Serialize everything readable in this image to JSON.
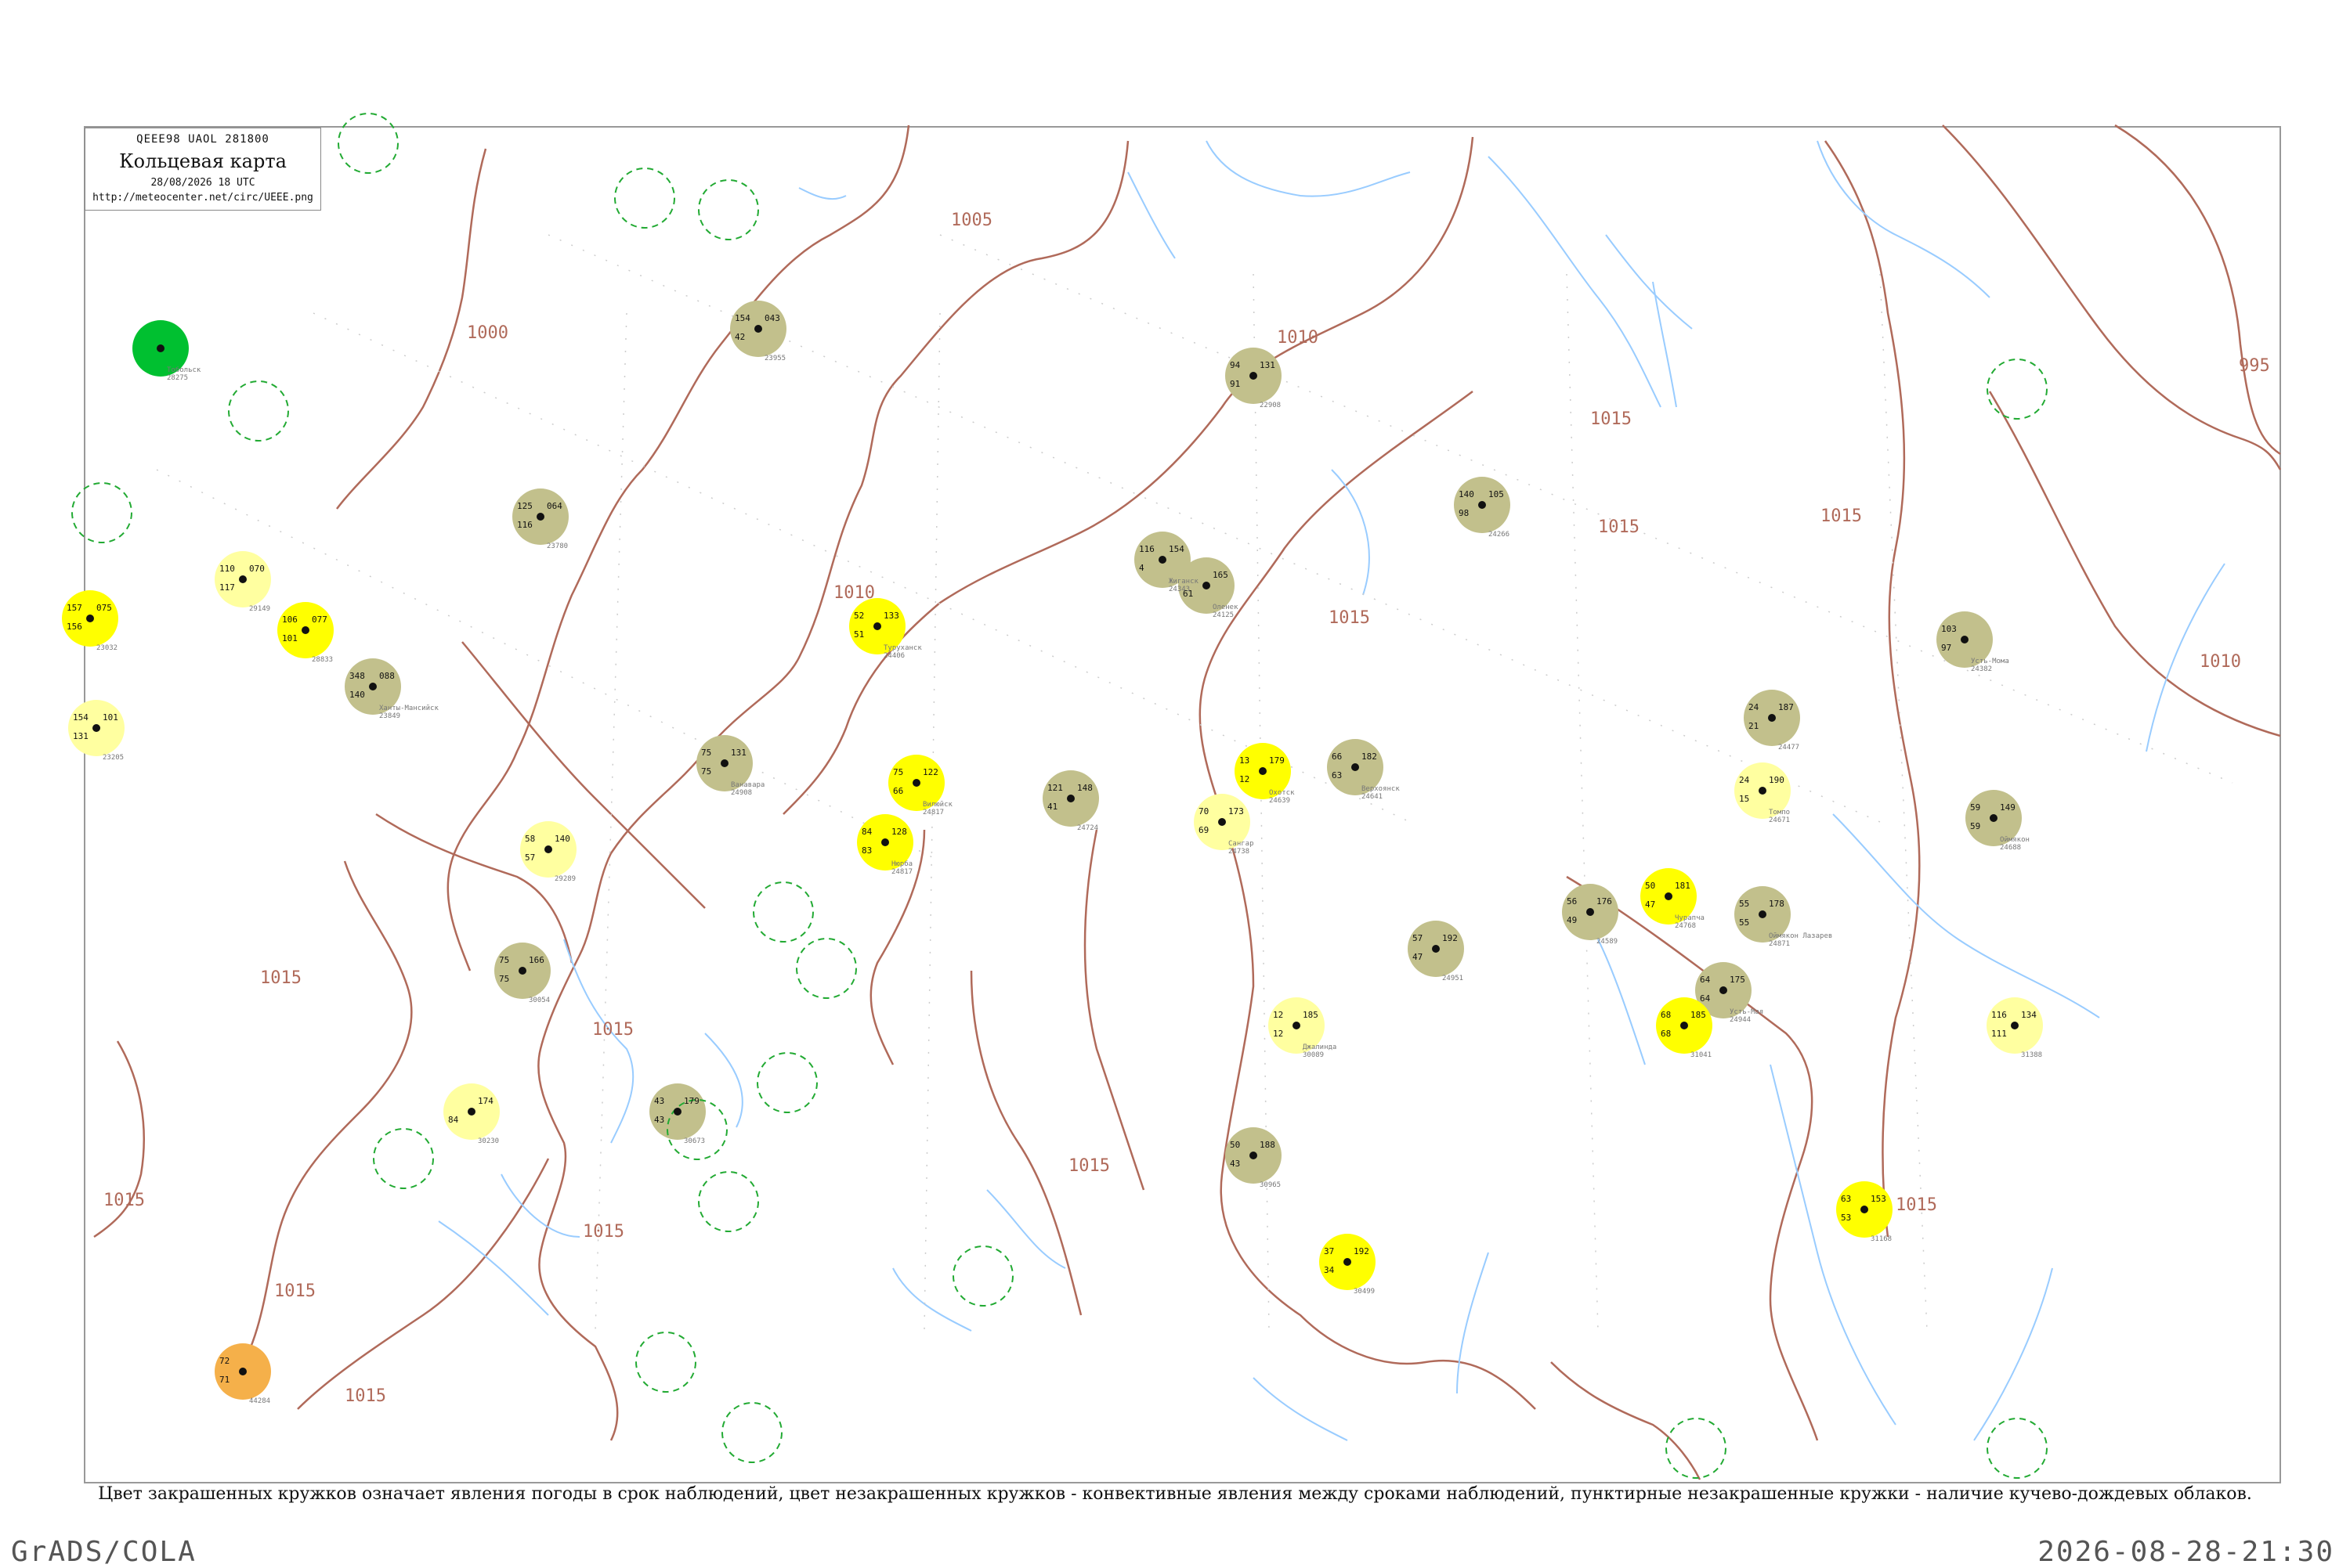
{
  "header": {
    "code_line": "QEEE98  UAOL  281800",
    "title": "Кольцевая карта",
    "date_line": "28/08/2026 18 UTC",
    "url": "http://meteocenter.net/circ/UEEE.png"
  },
  "caption": "Цвет закрашенных кружков означает явления погоды в срок наблюдений, цвет незакрашенных кружков - конвективные явления между сроками наблюдений, пунктирные незакрашенные кружки - наличие кучево-дождевых облаков.",
  "footer": {
    "left": "GrADS/COLA",
    "right": "2026-08-28-21:30"
  },
  "colors": {
    "green": "#00c030",
    "olive": "#c2c08c",
    "yellow": "#ffff00",
    "pale_yellow": "#ffffa0",
    "orange": "#f5b04a",
    "isobar": "#b06a5a",
    "river": "#99ccff",
    "frame": "#888888",
    "dashed_ring": "#22aa33"
  },
  "isobar_labels": [
    "995",
    "1000",
    "1005",
    "1010",
    "1010",
    "1010",
    "1015",
    "1015",
    "1015",
    "1015",
    "1015",
    "1015",
    "1015",
    "1015",
    "1015",
    "1015",
    "1015",
    "1015"
  ],
  "stations": [
    {
      "id": "24688",
      "name": "Оймякон",
      "color": "olive",
      "t": "59",
      "p": "149",
      "d": "59"
    },
    {
      "id": "24382",
      "name": "Усть-Мома",
      "color": "olive",
      "t": "103",
      "p": "",
      "d": "97"
    },
    {
      "id": "24671",
      "name": "Томпо",
      "color": "pale_yellow",
      "t": "24",
      "p": "190",
      "d": "15"
    },
    {
      "id": "24477",
      "name": "",
      "color": "olive",
      "t": "24",
      "p": "187",
      "d": "21"
    },
    {
      "id": "24871",
      "name": "Оймякон Лазарев",
      "color": "olive",
      "t": "55",
      "p": "178",
      "d": "55"
    },
    {
      "id": "24768",
      "name": "Чурапча",
      "color": "yellow",
      "t": "50",
      "p": "181",
      "d": "47"
    },
    {
      "id": "24641",
      "name": "Верхоянск",
      "color": "olive",
      "t": "66",
      "p": "182",
      "d": "63"
    },
    {
      "id": "24639",
      "name": "Охотск",
      "color": "yellow",
      "t": "13",
      "p": "179",
      "d": "12"
    },
    {
      "id": "24738",
      "name": "Сангар",
      "color": "pale_yellow",
      "t": "70",
      "p": "173",
      "d": "69"
    },
    {
      "id": "24724",
      "name": "",
      "color": "olive",
      "t": "121",
      "p": "148",
      "d": "41"
    },
    {
      "id": "24817",
      "name": "Вилюйск",
      "color": "yellow",
      "t": "75",
      "p": "122",
      "d": "66"
    },
    {
      "id": "24817",
      "name": "Нюрба",
      "color": "yellow",
      "t": "84",
      "p": "128",
      "d": "83"
    },
    {
      "id": "24908",
      "name": "Ванавара",
      "color": "olive",
      "t": "75",
      "p": "131",
      "d": "75"
    },
    {
      "id": "24406",
      "name": "Туруханск",
      "color": "yellow",
      "t": "52",
      "p": "133",
      "d": "51"
    },
    {
      "id": "24343",
      "name": "Жиганск",
      "color": "olive",
      "t": "116",
      "p": "154",
      "d": "4"
    },
    {
      "id": "24125",
      "name": "Оленек",
      "color": "olive",
      "t": "",
      "p": "165",
      "d": "61"
    },
    {
      "id": "22908",
      "name": "",
      "color": "olive",
      "t": "94",
      "p": "131",
      "d": "91"
    },
    {
      "id": "24944",
      "name": "Усть-Мая",
      "color": "olive",
      "t": "64",
      "p": "175",
      "d": "64"
    },
    {
      "id": "31041",
      "name": "",
      "color": "yellow",
      "t": "68",
      "p": "185",
      "d": "68"
    },
    {
      "id": "30089",
      "name": "Джалинда",
      "color": "pale_yellow",
      "t": "12",
      "p": "185",
      "d": "12"
    },
    {
      "id": "30499",
      "name": "",
      "color": "yellow",
      "t": "37",
      "p": "192",
      "d": "34"
    },
    {
      "id": "31168",
      "name": "",
      "color": "yellow",
      "t": "63",
      "p": "153",
      "d": "53"
    },
    {
      "id": "31388",
      "name": "",
      "color": "pale_yellow",
      "t": "116",
      "p": "134",
      "d": "111"
    },
    {
      "id": "28275",
      "name": "Тобольск",
      "color": "green",
      "t": "",
      "p": "",
      "d": ""
    },
    {
      "id": "23849",
      "name": "Ханты-Мансийск",
      "color": "olive",
      "t": "348",
      "p": "088",
      "d": "140"
    },
    {
      "id": "23955",
      "name": "",
      "color": "olive",
      "t": "154",
      "p": "043",
      "d": "42"
    },
    {
      "id": "23780",
      "name": "",
      "color": "olive",
      "t": "125",
      "p": "064",
      "d": "116"
    },
    {
      "id": "24266",
      "name": "",
      "color": "olive",
      "t": "140",
      "p": "105",
      "d": "98"
    },
    {
      "id": "30054",
      "name": "",
      "color": "olive",
      "t": "75",
      "p": "166",
      "d": "75"
    },
    {
      "id": "30673",
      "name": "",
      "color": "olive",
      "t": "43",
      "p": "179",
      "d": "43"
    },
    {
      "id": "30965",
      "name": "",
      "color": "olive",
      "t": "50",
      "p": "188",
      "d": "43"
    },
    {
      "id": "44284",
      "name": "",
      "color": "orange",
      "t": "72",
      "p": "",
      "d": "71"
    },
    {
      "id": "30230",
      "name": "",
      "color": "pale_yellow",
      "t": "",
      "p": "174",
      "d": "84"
    },
    {
      "id": "29289",
      "name": "",
      "color": "pale_yellow",
      "t": "58",
      "p": "140",
      "d": "57"
    },
    {
      "id": "23205",
      "name": "",
      "color": "pale_yellow",
      "t": "154",
      "p": "101",
      "d": "131"
    },
    {
      "id": "23032",
      "name": "",
      "color": "yellow",
      "t": "157",
      "p": "075",
      "d": "156"
    },
    {
      "id": "29149",
      "name": "",
      "color": "pale_yellow",
      "t": "110",
      "p": "070",
      "d": "117"
    },
    {
      "id": "28833",
      "name": "",
      "color": "yellow",
      "t": "106",
      "p": "077",
      "d": "101"
    },
    {
      "id": "24589",
      "name": "",
      "color": "olive",
      "t": "56",
      "p": "176",
      "d": "49"
    },
    {
      "id": "24951",
      "name": "",
      "color": "olive",
      "t": "57",
      "p": "192",
      "d": "47"
    }
  ]
}
